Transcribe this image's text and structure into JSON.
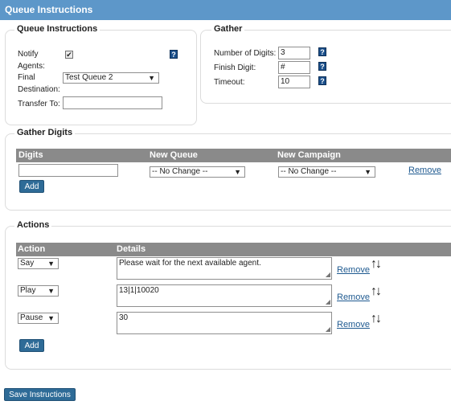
{
  "page": {
    "title": "Queue Instructions"
  },
  "queue_instructions": {
    "legend": "Queue Instructions",
    "notify_label_1": "Notify",
    "notify_label_2": "Agents:",
    "notify_checked": true,
    "notify_check_glyph": "✔",
    "final_label_1": "Final",
    "final_label_2": "Destination:",
    "final_value": "Test Queue 2",
    "transfer_label": "Transfer To:",
    "transfer_value": ""
  },
  "gather": {
    "legend": "Gather",
    "digits_label": "Number of Digits:",
    "digits_value": "3",
    "finish_label": "Finish Digit:",
    "finish_value": "#",
    "timeout_label": "Timeout:",
    "timeout_value": "10"
  },
  "help_glyph": "?",
  "dropdown_arrow": "▼",
  "gather_digits": {
    "legend": "Gather Digits",
    "col_digits": "Digits",
    "col_new_queue": "New Queue",
    "col_new_campaign": "New Campaign",
    "row": {
      "digits": "",
      "queue": "-- No Change --",
      "campaign": "-- No Change --",
      "remove": "Remove"
    },
    "add_label": "Add"
  },
  "actions": {
    "legend": "Actions",
    "col_action": "Action",
    "col_details": "Details",
    "rows": [
      {
        "action": "Say",
        "details": "Please wait for the next available agent.",
        "remove": "Remove"
      },
      {
        "action": "Play",
        "details": "13|1|10020",
        "remove": "Remove"
      },
      {
        "action": "Pause",
        "details": "30",
        "remove": "Remove"
      }
    ],
    "move_glyph": "↑↓",
    "resize_glyph": "◢",
    "add_label": "Add"
  },
  "save_label": "Save Instructions"
}
